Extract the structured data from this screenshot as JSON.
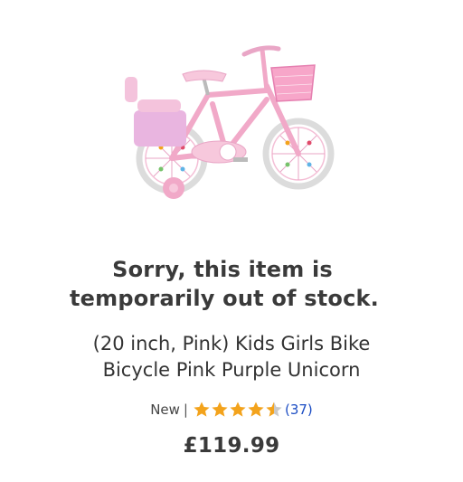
{
  "product": {
    "image_alt": "Pink kids bicycle with basket and training wheels",
    "stock_message_line1": "Sorry, this item is",
    "stock_message_line2": "temporarily out of stock.",
    "title_line1": "(20 inch, Pink) Kids Girls Bike",
    "title_line2": "Bicycle Pink Purple Unicorn",
    "condition": "New",
    "separator": "|",
    "rating": 4.5,
    "rating_max": 5,
    "review_count": "(37)",
    "price": "£119.99",
    "colors": {
      "star": "#f3a31c",
      "star_empty": "#c9c9c9",
      "link": "#1d4ec4",
      "bike_pink": "#f1a9c8",
      "bike_light_pink": "#f7c8dc",
      "tyre": "#dcdcdc"
    }
  }
}
